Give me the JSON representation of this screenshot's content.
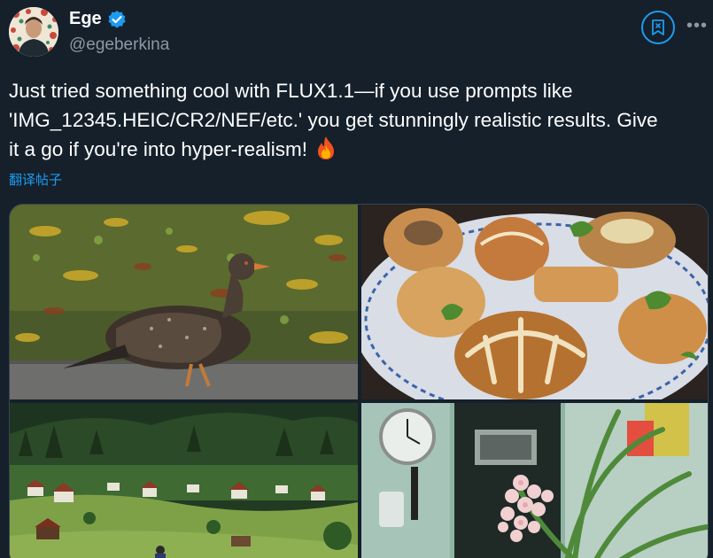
{
  "author": {
    "display_name": "Ege",
    "handle": "@egeberkina",
    "verified": true,
    "avatar_icon": "avatar-image"
  },
  "actions": {
    "bookmark_icon": "grok-icon",
    "more_label": "•••"
  },
  "tweet": {
    "lines": [
      "Just tried something cool with FLUX1.1—if you use prompts like",
      "'IMG_12345.HEIC/CR2/NEF/etc.' you get stunningly realistic results. Give",
      "it a go if you're into hyper-realism!"
    ],
    "emoji": "fire-emoji",
    "translate_label": "翻译帖子"
  },
  "media": [
    {
      "subject": "bird-on-road"
    },
    {
      "subject": "pastries-plate"
    },
    {
      "subject": "alpine-village"
    },
    {
      "subject": "flowers-room"
    }
  ],
  "colors": {
    "background": "#15202b",
    "accent": "#1d9bf0",
    "secondary_text": "#8b98a5",
    "primary_text": "#ffffff"
  }
}
